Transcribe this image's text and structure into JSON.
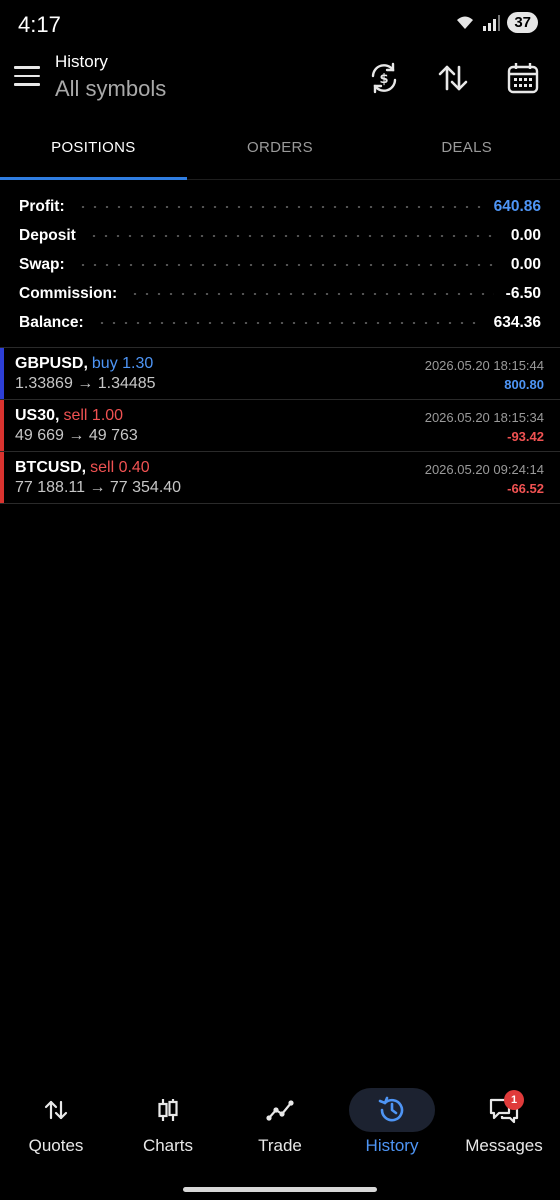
{
  "status_bar": {
    "time": "4:17",
    "battery": "37"
  },
  "header": {
    "subtitle": "History",
    "title": "All symbols",
    "icons": [
      "menu-icon",
      "currency-exchange-icon",
      "sort-icon",
      "calendar-icon"
    ]
  },
  "tabs": [
    {
      "label": "POSITIONS",
      "active": true
    },
    {
      "label": "ORDERS",
      "active": false
    },
    {
      "label": "DEALS",
      "active": false
    }
  ],
  "summary": {
    "profit": {
      "label": "Profit:",
      "value": "640.86"
    },
    "deposit": {
      "label": "Deposit",
      "value": "0.00"
    },
    "swap": {
      "label": "Swap:",
      "value": "0.00"
    },
    "commission": {
      "label": "Commission:",
      "value": "-6.50"
    },
    "balance": {
      "label": "Balance:",
      "value": "634.36"
    }
  },
  "positions": [
    {
      "symbol": "GBPUSD,",
      "side": "buy 1.30",
      "prices": "1.33869 → 1.34485",
      "time": "2026.05.20 18:15:44",
      "profit": "800.80"
    },
    {
      "symbol": "US30,",
      "side": "sell 1.00",
      "prices": "49 669 → 49 763",
      "time": "2026.05.20 18:15:34",
      "profit": "-93.42"
    },
    {
      "symbol": "BTCUSD,",
      "side": "sell 0.40",
      "prices": "77 188.11 → 77 354.40",
      "time": "2026.05.20 09:24:14",
      "profit": "-66.52"
    }
  ],
  "bottom_nav": [
    {
      "label": "Quotes",
      "icon": "quotes-icon"
    },
    {
      "label": "Charts",
      "icon": "charts-icon"
    },
    {
      "label": "Trade",
      "icon": "trade-icon"
    },
    {
      "label": "History",
      "icon": "history-icon",
      "active": true
    },
    {
      "label": "Messages",
      "icon": "messages-icon",
      "badge": "1"
    }
  ],
  "colors": {
    "accent": "#2f7de1",
    "profit_positive": "#4e95f5",
    "profit_negative": "#f05252",
    "buy_bar": "#2d3fd6",
    "sell_bar": "#d9332f"
  }
}
